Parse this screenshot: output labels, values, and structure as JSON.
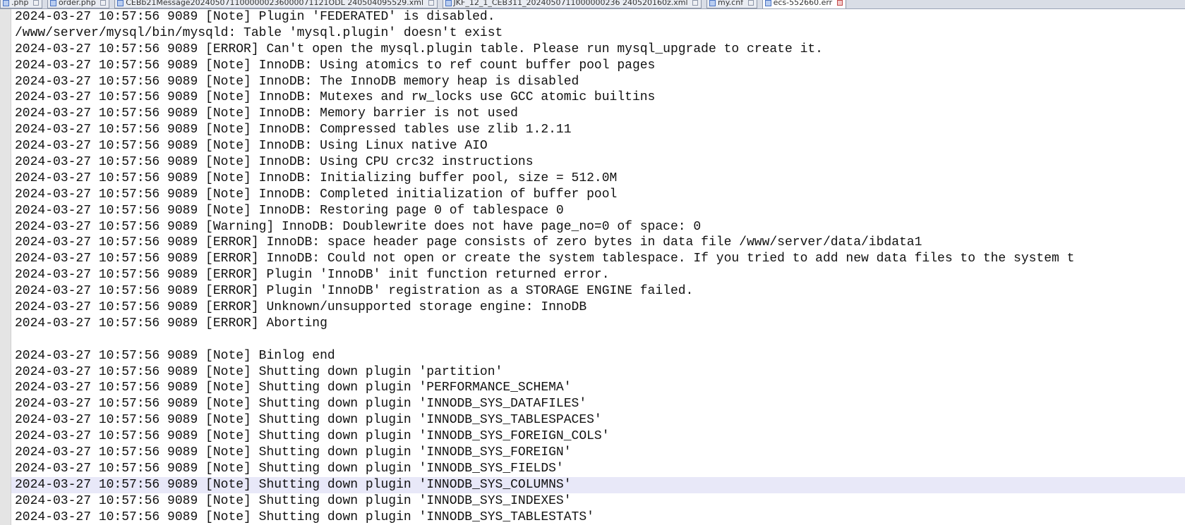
{
  "tabs": [
    {
      "label": ".php",
      "active": false
    },
    {
      "label": "order.php",
      "active": false
    },
    {
      "label": "CEBb21Message2024050711000000236000071121ODL 240504095529.xml",
      "active": false
    },
    {
      "label": "JKF_12_1_CEB311_2024050711000000236 240520160z.xml",
      "active": false
    },
    {
      "label": "my.cnf",
      "active": false
    },
    {
      "label": "ecs-552660.err",
      "active": true
    }
  ],
  "editor": {
    "current_line_index": 29,
    "lines": [
      "2024-03-27 10:57:56 9089 [Note] Plugin 'FEDERATED' is disabled.",
      "/www/server/mysql/bin/mysqld: Table 'mysql.plugin' doesn't exist",
      "2024-03-27 10:57:56 9089 [ERROR] Can't open the mysql.plugin table. Please run mysql_upgrade to create it.",
      "2024-03-27 10:57:56 9089 [Note] InnoDB: Using atomics to ref count buffer pool pages",
      "2024-03-27 10:57:56 9089 [Note] InnoDB: The InnoDB memory heap is disabled",
      "2024-03-27 10:57:56 9089 [Note] InnoDB: Mutexes and rw_locks use GCC atomic builtins",
      "2024-03-27 10:57:56 9089 [Note] InnoDB: Memory barrier is not used",
      "2024-03-27 10:57:56 9089 [Note] InnoDB: Compressed tables use zlib 1.2.11",
      "2024-03-27 10:57:56 9089 [Note] InnoDB: Using Linux native AIO",
      "2024-03-27 10:57:56 9089 [Note] InnoDB: Using CPU crc32 instructions",
      "2024-03-27 10:57:56 9089 [Note] InnoDB: Initializing buffer pool, size = 512.0M",
      "2024-03-27 10:57:56 9089 [Note] InnoDB: Completed initialization of buffer pool",
      "2024-03-27 10:57:56 9089 [Note] InnoDB: Restoring page 0 of tablespace 0",
      "2024-03-27 10:57:56 9089 [Warning] InnoDB: Doublewrite does not have page_no=0 of space: 0",
      "2024-03-27 10:57:56 9089 [ERROR] InnoDB: space header page consists of zero bytes in data file /www/server/data/ibdata1",
      "2024-03-27 10:57:56 9089 [ERROR] InnoDB: Could not open or create the system tablespace. If you tried to add new data files to the system t",
      "2024-03-27 10:57:56 9089 [ERROR] Plugin 'InnoDB' init function returned error.",
      "2024-03-27 10:57:56 9089 [ERROR] Plugin 'InnoDB' registration as a STORAGE ENGINE failed.",
      "2024-03-27 10:57:56 9089 [ERROR] Unknown/unsupported storage engine: InnoDB",
      "2024-03-27 10:57:56 9089 [ERROR] Aborting",
      "",
      "2024-03-27 10:57:56 9089 [Note] Binlog end",
      "2024-03-27 10:57:56 9089 [Note] Shutting down plugin 'partition'",
      "2024-03-27 10:57:56 9089 [Note] Shutting down plugin 'PERFORMANCE_SCHEMA'",
      "2024-03-27 10:57:56 9089 [Note] Shutting down plugin 'INNODB_SYS_DATAFILES'",
      "2024-03-27 10:57:56 9089 [Note] Shutting down plugin 'INNODB_SYS_TABLESPACES'",
      "2024-03-27 10:57:56 9089 [Note] Shutting down plugin 'INNODB_SYS_FOREIGN_COLS'",
      "2024-03-27 10:57:56 9089 [Note] Shutting down plugin 'INNODB_SYS_FOREIGN'",
      "2024-03-27 10:57:56 9089 [Note] Shutting down plugin 'INNODB_SYS_FIELDS'",
      "2024-03-27 10:57:56 9089 [Note] Shutting down plugin 'INNODB_SYS_COLUMNS'",
      "2024-03-27 10:57:56 9089 [Note] Shutting down plugin 'INNODB_SYS_INDEXES'",
      "2024-03-27 10:57:56 9089 [Note] Shutting down plugin 'INNODB_SYS_TABLESTATS'"
    ]
  }
}
